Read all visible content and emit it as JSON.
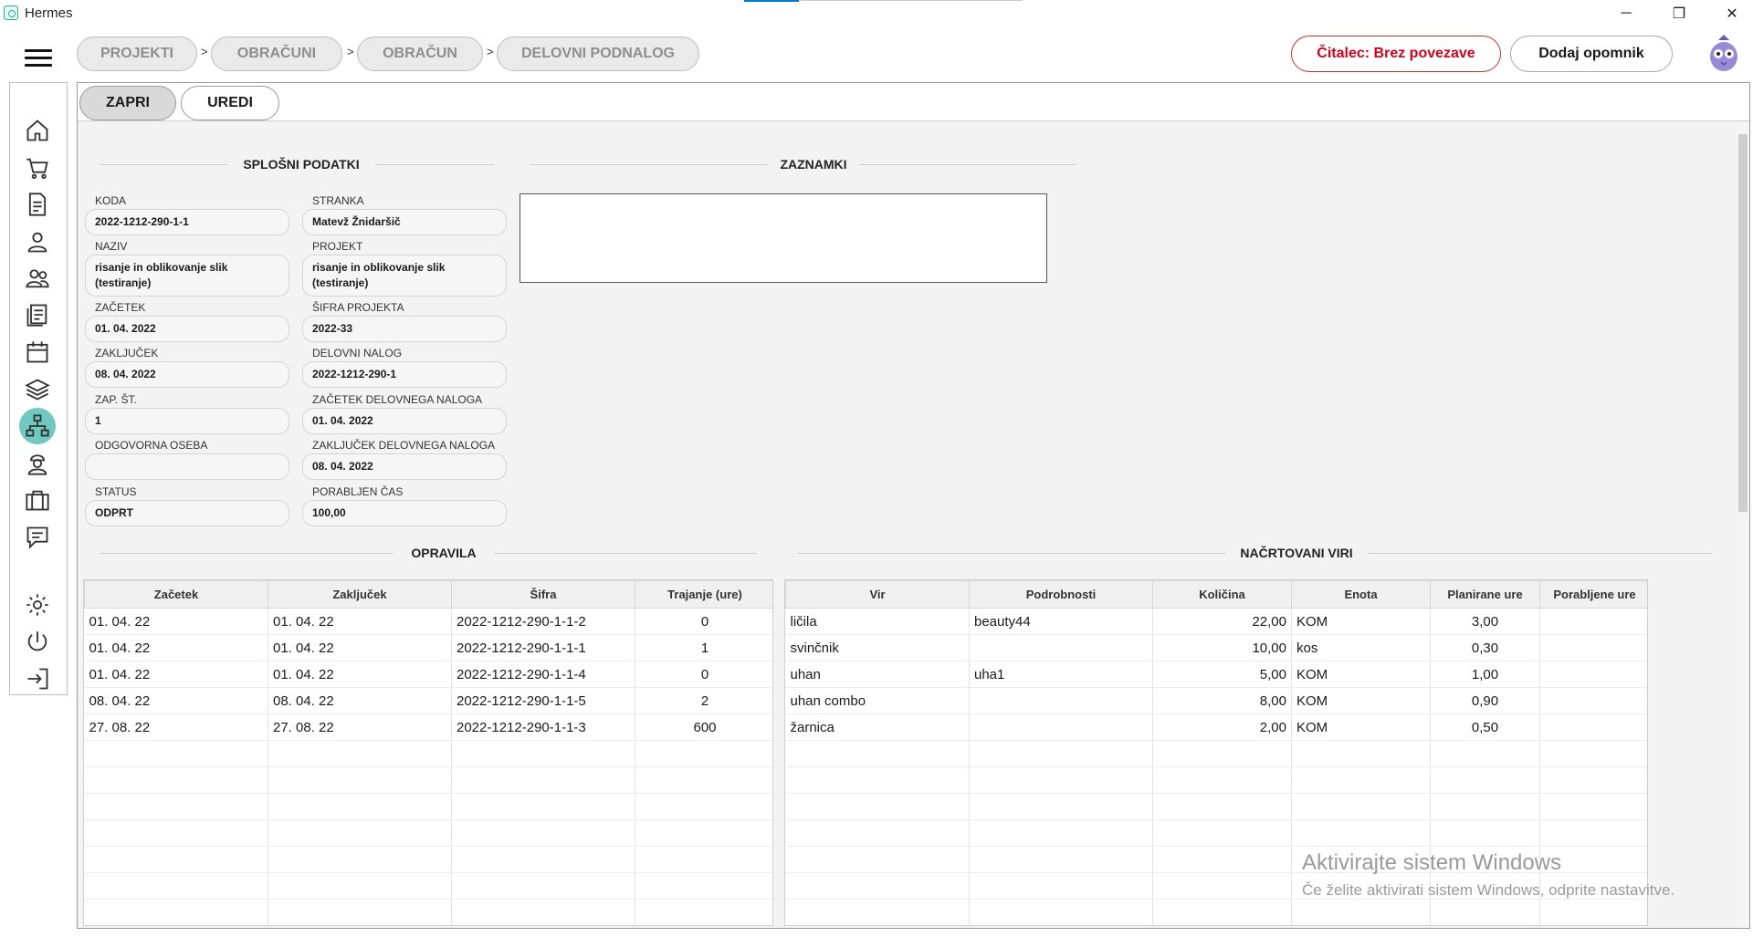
{
  "app": {
    "title": "Hermes"
  },
  "window_controls": {
    "minimize": "─",
    "maximize": "❐",
    "close": "✕"
  },
  "breadcrumb": [
    "PROJEKTI",
    "OBRAČUNI",
    "OBRAČUN",
    "DELOVNI PODNALOG"
  ],
  "breadcrumb_sep": ">",
  "header": {
    "reader_label": "Čitalec: Brez povezave",
    "add_reminder_label": "Dodaj opomnik"
  },
  "colors": {
    "accent": "#6fc9c0",
    "reader_text": "#d0021b"
  },
  "sidebar": {
    "items": [
      "home-icon",
      "cart-icon",
      "document-icon",
      "person-icon",
      "people-icon",
      "reports-icon",
      "calendar-icon",
      "layers-icon",
      "hierarchy-icon",
      "worker-icon",
      "briefcase-icon",
      "chat-icon",
      "settings-icon",
      "power-icon",
      "logout-icon"
    ],
    "active": "hierarchy-icon"
  },
  "toolbar": {
    "close_label": "ZAPRI",
    "edit_label": "UREDI"
  },
  "general": {
    "title": "SPLOŠNI PODATKI",
    "fields": [
      {
        "label": "KODA",
        "value": "2022-1212-290-1-1"
      },
      {
        "label": "STRANKA",
        "value": "Matevž Žnidaršič"
      },
      {
        "label": "NAZIV",
        "value": "risanje in oblikovanje slik (testiranje)"
      },
      {
        "label": "PROJEKT",
        "value": "risanje in oblikovanje slik (testiranje)"
      },
      {
        "label": "ZAČETEK",
        "value": "01. 04. 2022"
      },
      {
        "label": "ŠIFRA PROJEKTA",
        "value": "2022-33"
      },
      {
        "label": "ZAKLJUČEK",
        "value": "08. 04. 2022"
      },
      {
        "label": "DELOVNI NALOG",
        "value": "2022-1212-290-1"
      },
      {
        "label": "ZAP. ŠT.",
        "value": "1"
      },
      {
        "label": "ZAČETEK DELOVNEGA NALOGA",
        "value": "01. 04. 2022"
      },
      {
        "label": "ODGOVORNA OSEBA",
        "value": ""
      },
      {
        "label": "ZAKLJUČEK DELOVNEGA NALOGA",
        "value": "08. 04. 2022"
      },
      {
        "label": "STATUS",
        "value": "ODPRT"
      },
      {
        "label": "PORABLJEN ČAS",
        "value": "100,00"
      }
    ]
  },
  "notes": {
    "title": "ZAZNAMKI",
    "value": ""
  },
  "tasks": {
    "title": "OPRAVILA",
    "columns": [
      "Začetek",
      "Zaključek",
      "Šifra",
      "Trajanje (ure)"
    ],
    "rows": [
      [
        "01. 04. 22",
        "01. 04. 22",
        "2022-1212-290-1-1-2",
        "0"
      ],
      [
        "01. 04. 22",
        "01. 04. 22",
        "2022-1212-290-1-1-1",
        "1"
      ],
      [
        "01. 04. 22",
        "01. 04. 22",
        "2022-1212-290-1-1-4",
        "0"
      ],
      [
        "08. 04. 22",
        "08. 04. 22",
        "2022-1212-290-1-1-5",
        "2"
      ],
      [
        "27. 08. 22",
        "27. 08. 22",
        "2022-1212-290-1-1-3",
        "600"
      ]
    ]
  },
  "resources": {
    "title": "NAČRTOVANI VIRI",
    "columns": [
      "Vir",
      "Podrobnosti",
      "Količina",
      "Enota",
      "Planirane ure",
      "Porabljene ure"
    ],
    "rows": [
      [
        "ličila",
        "beauty44",
        "22,00",
        "KOM",
        "3,00",
        ""
      ],
      [
        "svinčnik",
        "",
        "10,00",
        "kos",
        "0,30",
        ""
      ],
      [
        "uhan",
        "uha1",
        "5,00",
        "KOM",
        "1,00",
        ""
      ],
      [
        "uhan combo",
        "",
        "8,00",
        "KOM",
        "0,90",
        ""
      ],
      [
        "žarnica",
        "",
        "2,00",
        "KOM",
        "0,50",
        ""
      ]
    ]
  },
  "watermark": {
    "line1": "Aktivirajte sistem Windows",
    "line2": "Če želite aktivirati sistem Windows, odprite nastavitve."
  }
}
